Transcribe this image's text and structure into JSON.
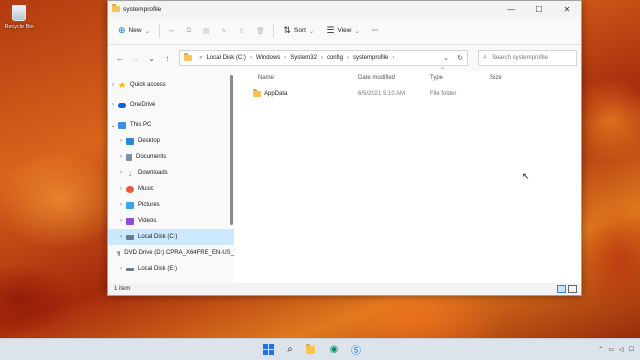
{
  "desktop": {
    "recycle_bin_label": "Recycle Bin"
  },
  "window": {
    "title": "systemprofile",
    "controls": {
      "minimize": "—",
      "maximize": "☐",
      "close": "✕"
    }
  },
  "toolbar": {
    "new_label": "New",
    "sort_label": "Sort",
    "view_label": "View",
    "more_label": "···"
  },
  "address": {
    "crumbs": [
      "Local Disk (C:)",
      "Windows",
      "System32",
      "config",
      "systemprofile"
    ],
    "search_placeholder": "Search systemprofile"
  },
  "nav": {
    "items": [
      {
        "label": "Quick access",
        "icon": "star-icon",
        "color": "#f4b400"
      },
      {
        "label": "OneDrive",
        "icon": "cloud-icon",
        "color": "#0a64d8"
      },
      {
        "label": "This PC",
        "icon": "computer-icon",
        "color": "#3a8ee6"
      },
      {
        "label": "Desktop",
        "icon": "desktop-icon",
        "color": "#2b88d8"
      },
      {
        "label": "Documents",
        "icon": "documents-icon",
        "color": "#7b8ea6"
      },
      {
        "label": "Downloads",
        "icon": "download-icon",
        "color": "#1c9a5a"
      },
      {
        "label": "Music",
        "icon": "music-icon",
        "color": "#e8593b"
      },
      {
        "label": "Pictures",
        "icon": "pictures-icon",
        "color": "#3ba4e8"
      },
      {
        "label": "Videos",
        "icon": "videos-icon",
        "color": "#8b4fd9"
      },
      {
        "label": "Local Disk (C:)",
        "icon": "drive-icon",
        "color": "#6c7a89"
      },
      {
        "label": "DVD Drive (D:) CPRA_X64FRE_EN-US_",
        "icon": "dvd-icon",
        "color": "#8d98a4"
      },
      {
        "label": "Local Disk (E:)",
        "icon": "drive-icon",
        "color": "#6c7a89"
      }
    ]
  },
  "columns": {
    "name": "Name",
    "date": "Date modified",
    "type": "Type",
    "size": "Size"
  },
  "files": [
    {
      "name": "AppData",
      "date": "6/5/2021 5:10 AM",
      "type": "File folder",
      "size": ""
    }
  ],
  "status": {
    "item_count": "1 item"
  }
}
